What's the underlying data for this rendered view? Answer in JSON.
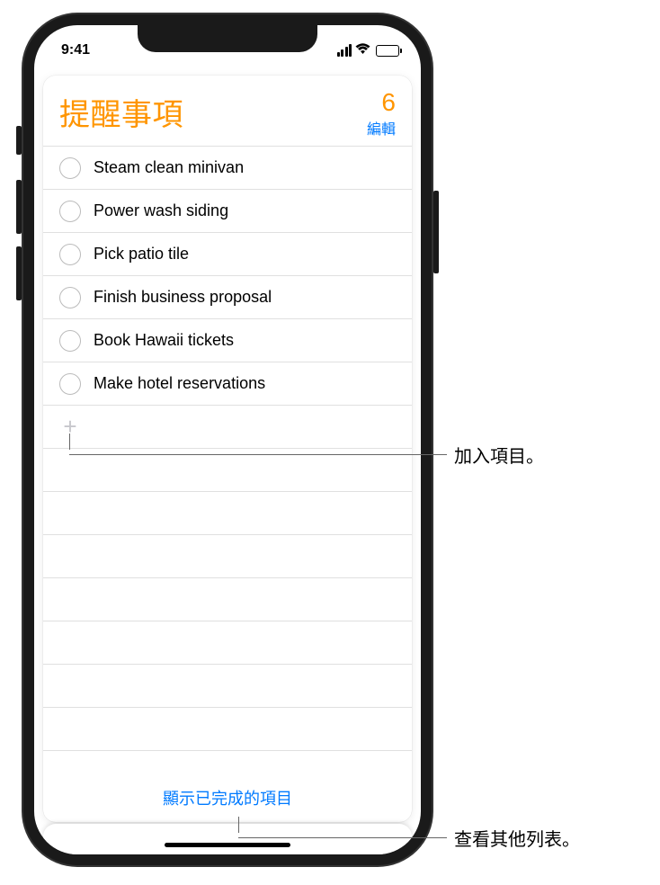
{
  "status": {
    "time": "9:41"
  },
  "header": {
    "title": "提醒事項",
    "count": "6",
    "edit": "編輯"
  },
  "reminders": [
    {
      "text": "Steam clean minivan"
    },
    {
      "text": "Power wash siding"
    },
    {
      "text": "Pick patio tile"
    },
    {
      "text": "Finish business proposal"
    },
    {
      "text": "Book Hawaii tickets"
    },
    {
      "text": "Make hotel reservations"
    }
  ],
  "footer": {
    "show_completed": "顯示已完成的項目"
  },
  "callouts": {
    "add_item": "加入項目。",
    "view_lists": "查看其他列表。"
  }
}
